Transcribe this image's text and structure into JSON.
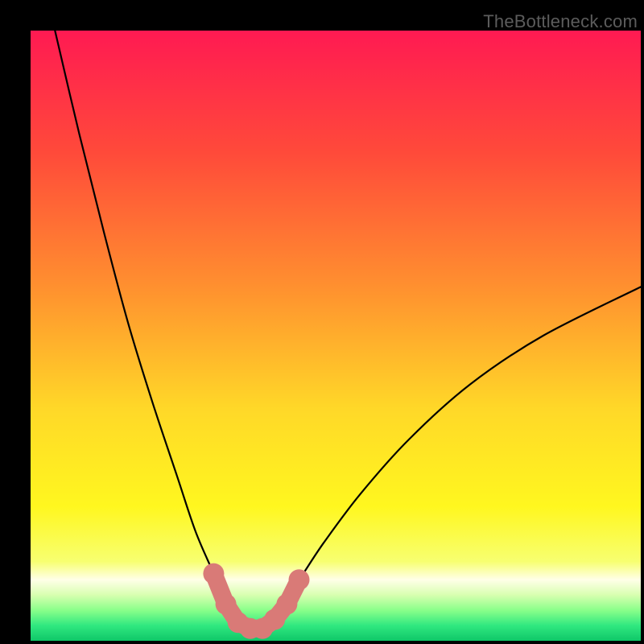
{
  "watermark": "TheBottleneck.com",
  "chart_data": {
    "type": "line",
    "title": "",
    "xlabel": "",
    "ylabel": "",
    "xlim": [
      0,
      100
    ],
    "ylim": [
      0,
      100
    ],
    "grid": false,
    "legend": false,
    "series": [
      {
        "name": "bottleneck-curve",
        "color": "#000000",
        "x": [
          4,
          8,
          12,
          16,
          20,
          24,
          27,
          30,
          32,
          34,
          35.5,
          37,
          39,
          41,
          44,
          48,
          54,
          62,
          72,
          84,
          100
        ],
        "y": [
          100,
          83,
          67,
          52,
          39,
          27,
          18,
          11,
          6,
          3,
          2,
          2,
          3,
          6,
          10,
          16,
          24,
          33,
          42,
          50,
          58
        ]
      }
    ],
    "markers": {
      "name": "highlighted-range",
      "color": "#d97a77",
      "points": [
        {
          "x": 30,
          "y": 11
        },
        {
          "x": 32,
          "y": 6
        },
        {
          "x": 34,
          "y": 3
        },
        {
          "x": 36,
          "y": 2
        },
        {
          "x": 38,
          "y": 2
        },
        {
          "x": 40,
          "y": 3.5
        },
        {
          "x": 42,
          "y": 6
        },
        {
          "x": 44,
          "y": 10
        }
      ]
    },
    "background_gradient": {
      "stops": [
        {
          "pos": 0.0,
          "color": "#ff1a52"
        },
        {
          "pos": 0.2,
          "color": "#ff4a3a"
        },
        {
          "pos": 0.42,
          "color": "#ff902f"
        },
        {
          "pos": 0.62,
          "color": "#ffd828"
        },
        {
          "pos": 0.78,
          "color": "#fff71f"
        },
        {
          "pos": 0.87,
          "color": "#f7ff70"
        },
        {
          "pos": 0.9,
          "color": "#ffffe8"
        },
        {
          "pos": 0.925,
          "color": "#d8ffb0"
        },
        {
          "pos": 0.95,
          "color": "#8aff8a"
        },
        {
          "pos": 0.975,
          "color": "#30e880"
        },
        {
          "pos": 1.0,
          "color": "#0fc768"
        }
      ]
    }
  }
}
